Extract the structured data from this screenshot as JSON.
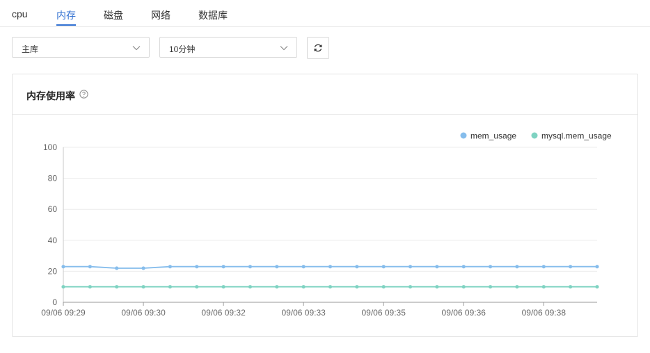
{
  "tabs": [
    {
      "label": "cpu",
      "active": false
    },
    {
      "label": "内存",
      "active": true
    },
    {
      "label": "磁盘",
      "active": false
    },
    {
      "label": "网络",
      "active": false
    },
    {
      "label": "数据库",
      "active": false
    }
  ],
  "filters": {
    "instance": "主库",
    "range": "10分钟"
  },
  "card": {
    "title": "内存使用率"
  },
  "colors": {
    "accent": "#2f6fd1",
    "mem_usage": "#86bdec",
    "mysql_mem_usage": "#7fd3c2"
  },
  "chart_data": {
    "type": "line",
    "title": "",
    "xlabel": "",
    "ylabel": "",
    "ylim": [
      0,
      100
    ],
    "yticks": [
      0,
      20,
      40,
      60,
      80,
      100
    ],
    "x_tick_labels": [
      "09/06 09:29",
      "09/06 09:30",
      "09/06 09:32",
      "09/06 09:33",
      "09/06 09:35",
      "09/06 09:36",
      "09/06 09:38"
    ],
    "x_tick_every": 3,
    "grid": true,
    "legend": "top-right",
    "series": [
      {
        "name": "mem_usage",
        "color": "#86bdec",
        "values": [
          23,
          23,
          22,
          22,
          23,
          23,
          23,
          23,
          23,
          23,
          23,
          23,
          23,
          23,
          23,
          23,
          23,
          23,
          23,
          23,
          23
        ]
      },
      {
        "name": "mysql.mem_usage",
        "color": "#7fd3c2",
        "values": [
          10,
          10,
          10,
          10,
          10,
          10,
          10,
          10,
          10,
          10,
          10,
          10,
          10,
          10,
          10,
          10,
          10,
          10,
          10,
          10,
          10
        ]
      }
    ]
  }
}
